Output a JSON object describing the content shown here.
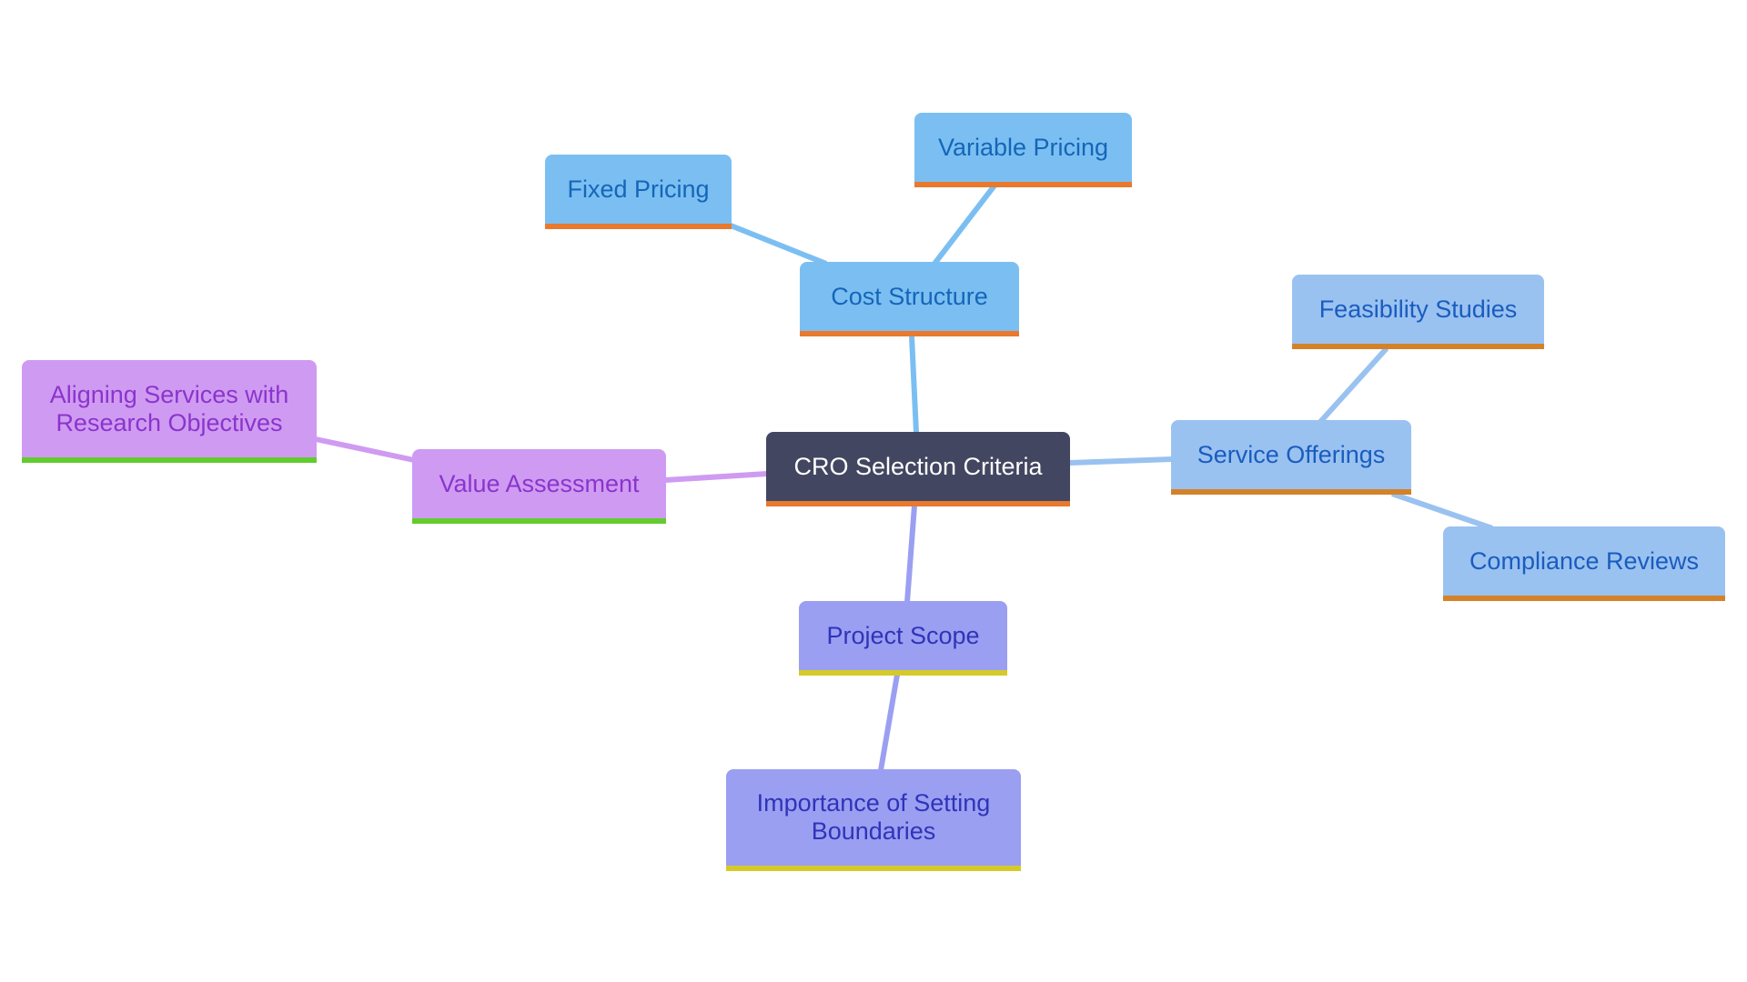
{
  "diagram": {
    "type": "mind-map",
    "root": {
      "id": "root",
      "label": "CRO Selection Criteria"
    },
    "nodes": [
      {
        "id": "cost",
        "label": "Cost Structure",
        "parent": "root",
        "theme": "cost"
      },
      {
        "id": "fixed",
        "label": "Fixed Pricing",
        "parent": "cost",
        "theme": "cost"
      },
      {
        "id": "variable",
        "label": "Variable Pricing",
        "parent": "cost",
        "theme": "cost"
      },
      {
        "id": "service",
        "label": "Service Offerings",
        "parent": "root",
        "theme": "service"
      },
      {
        "id": "feasibility",
        "label": "Feasibility Studies",
        "parent": "service",
        "theme": "service"
      },
      {
        "id": "compliance",
        "label": "Compliance Reviews",
        "parent": "service",
        "theme": "service"
      },
      {
        "id": "value",
        "label": "Value Assessment",
        "parent": "root",
        "theme": "value"
      },
      {
        "id": "aligning",
        "label": "Aligning Services with Research Objectives",
        "label_lines": [
          "Aligning Services with",
          "Research Objectives"
        ],
        "parent": "value",
        "theme": "value"
      },
      {
        "id": "scope",
        "label": "Project Scope",
        "parent": "root",
        "theme": "scope"
      },
      {
        "id": "importance",
        "label": "Importance of Setting Boundaries",
        "label_lines": [
          "Importance of Setting",
          "Boundaries"
        ],
        "parent": "scope",
        "theme": "scope"
      }
    ],
    "colors": {
      "root_fill": "#424660",
      "root_text": "#ffffff",
      "root_underline": "#e8792e",
      "cost_fill": "#7bbff2",
      "cost_text": "#1566b8",
      "cost_underline": "#e8792e",
      "cost_edge": "#7bbff2",
      "service_fill": "#9ac2f0",
      "service_text": "#1a5cbf",
      "service_underline": "#d4822a",
      "service_edge": "#9ac2f0",
      "value_fill": "#cf9bf2",
      "value_text": "#8b34cc",
      "value_underline": "#62cc2e",
      "value_edge": "#cf9bf2",
      "scope_fill": "#9b9ff2",
      "scope_text": "#2f34b8",
      "scope_underline": "#d6c92a",
      "scope_edge": "#9b9ff2"
    }
  }
}
